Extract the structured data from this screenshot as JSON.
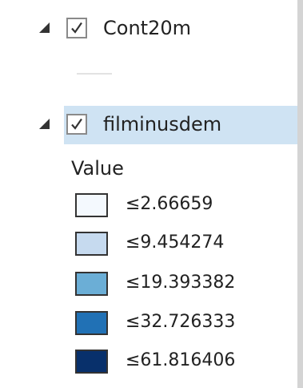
{
  "layers": [
    {
      "name": "Cont20m",
      "checked": true,
      "expanded": true,
      "selected": false
    },
    {
      "name": "filminusdem",
      "checked": true,
      "expanded": true,
      "selected": true
    }
  ],
  "raster_legend": {
    "heading": "Value",
    "classes": [
      {
        "label": "≤2.66659",
        "color": "#f4f9fe"
      },
      {
        "label": "≤9.454274",
        "color": "#c6daef"
      },
      {
        "label": "≤19.393382",
        "color": "#6baed6"
      },
      {
        "label": "≤32.726333",
        "color": "#2171b5"
      },
      {
        "label": "≤61.816406",
        "color": "#08306b"
      }
    ]
  },
  "colors": {
    "selection_highlight": "#cfe3f3",
    "line_symbol": "#e2e2e2"
  },
  "icons": {
    "expander": "triangle-down-right-icon",
    "checkbox": "checkmark-icon"
  }
}
